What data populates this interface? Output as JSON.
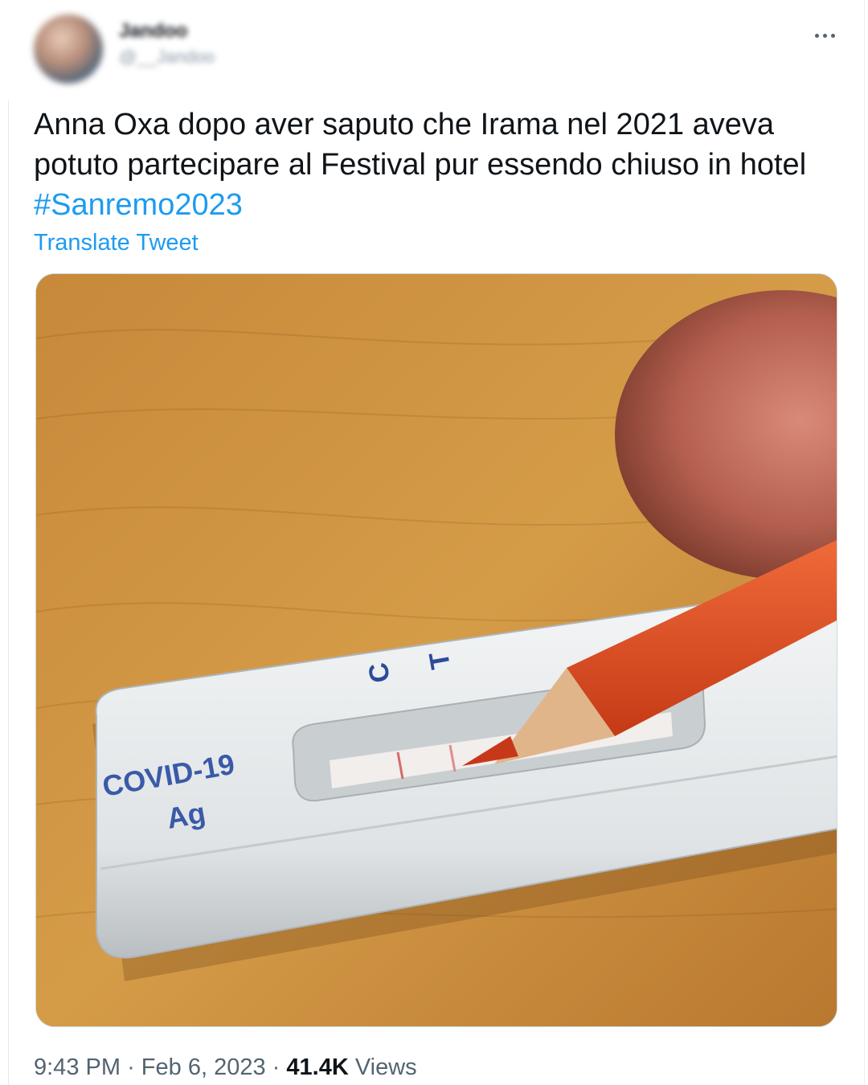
{
  "author": {
    "name": "Jandoo",
    "handle": "@__Jandoo"
  },
  "more_icon": "more-horizontal-icon",
  "tweet": {
    "text": "Anna Oxa dopo aver saputo che Irama nel 2021 aveva potuto partecipare al Festival pur essendo chiuso in hotel ",
    "hashtag": "#Sanremo2023",
    "translate_label": "Translate Tweet"
  },
  "media": {
    "test_label_line1": "COVID-19",
    "test_label_line2": "Ag",
    "marker_c": "C",
    "marker_t": "T"
  },
  "meta": {
    "time": "9:43 PM",
    "separator": "·",
    "date": "Feb 6, 2023",
    "views_count": "41.4K",
    "views_label": "Views"
  },
  "colors": {
    "link": "#1d9bf0",
    "text": "#0f1419",
    "secondary": "#536471"
  }
}
